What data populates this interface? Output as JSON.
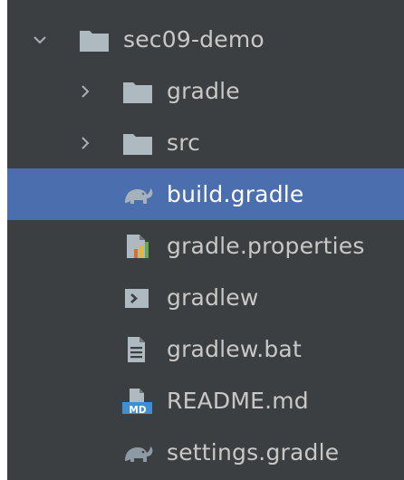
{
  "project_tree": {
    "items": [
      {
        "label": "sec09-demo",
        "icon": "folder-icon",
        "level": 0,
        "expandable": true,
        "expanded": true
      },
      {
        "label": "gradle",
        "icon": "folder-icon",
        "level": 1,
        "expandable": true,
        "expanded": false
      },
      {
        "label": "src",
        "icon": "folder-icon",
        "level": 1,
        "expandable": true,
        "expanded": false
      },
      {
        "label": "build.gradle",
        "icon": "gradle-elephant-icon",
        "level": 1,
        "selected": true
      },
      {
        "label": "gradle.properties",
        "icon": "properties-file-icon",
        "level": 1
      },
      {
        "label": "gradlew",
        "icon": "shell-script-icon",
        "level": 1
      },
      {
        "label": "gradlew.bat",
        "icon": "text-file-icon",
        "level": 1
      },
      {
        "label": "README.md",
        "icon": "markdown-file-icon",
        "level": 1,
        "badge": "MD"
      },
      {
        "label": "settings.gradle",
        "icon": "gradle-elephant-icon",
        "level": 1
      }
    ]
  },
  "colors": {
    "panel_background": "#3c3f41",
    "selection": "#4b6eaf",
    "text": "#c8c8c8",
    "folder": "#aeb9c0"
  }
}
